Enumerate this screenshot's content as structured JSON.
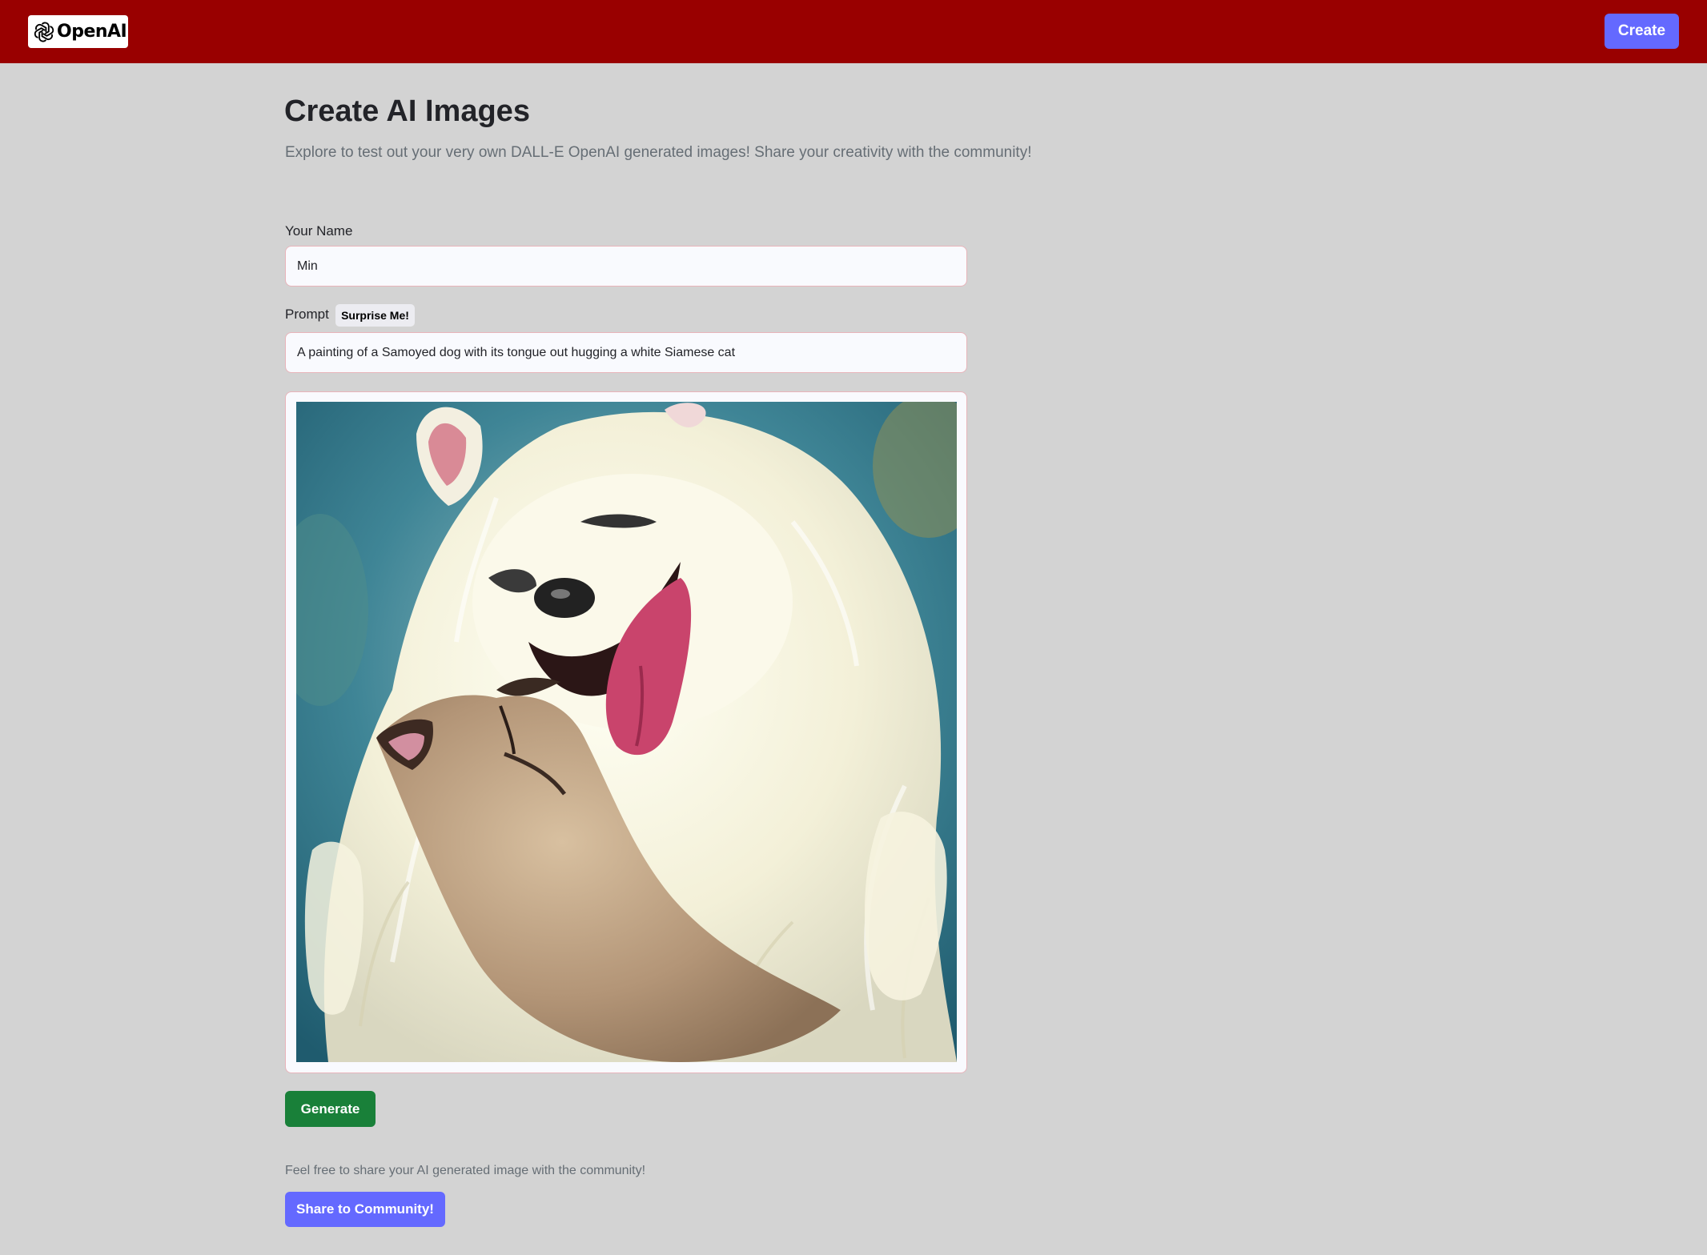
{
  "header": {
    "logo_text": "OpenAI",
    "logo_icon": "openai-logo-icon",
    "create_label": "Create"
  },
  "page": {
    "title": "Create AI Images",
    "subtitle": "Explore to test out your very own DALL-E OpenAI generated images! Share your creativity with the community!"
  },
  "form": {
    "name_label": "Your Name",
    "name_value": "Min",
    "prompt_label": "Prompt",
    "surprise_label": "Surprise Me!",
    "prompt_value": "A painting of a Samoyed dog with its tongue out hugging a white Siamese cat",
    "generate_label": "Generate"
  },
  "share": {
    "note": "Feel free to share your AI generated image with the community!",
    "button_label": "Share to Community!"
  },
  "colors": {
    "header_bg": "#990000",
    "page_bg": "#d3d3d3",
    "accent": "#6469ff",
    "generate": "#198039"
  }
}
